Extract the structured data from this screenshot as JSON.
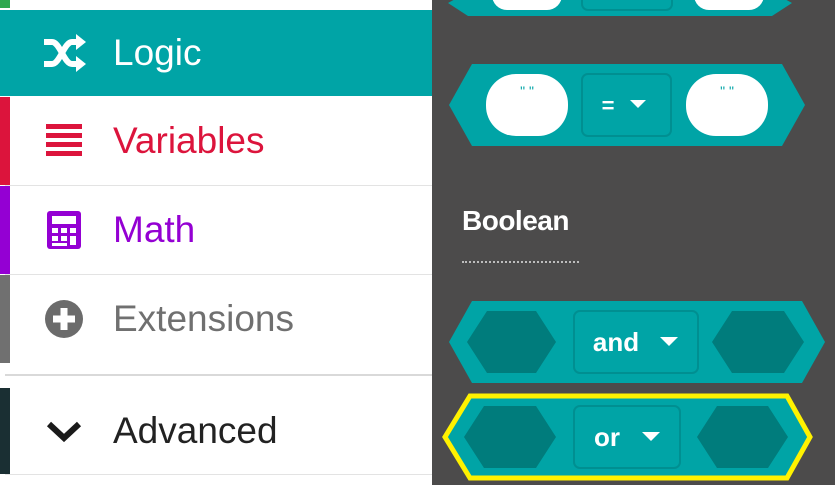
{
  "toolbox": {
    "categories": [
      {
        "label": "Logic",
        "icon": "shuffle-icon",
        "color": "#00a4a6",
        "selected": true
      },
      {
        "label": "Variables",
        "icon": "list-icon",
        "color": "#dc143c",
        "selected": false
      },
      {
        "label": "Math",
        "icon": "calculator-icon",
        "color": "#9400d3",
        "selected": false
      },
      {
        "label": "Extensions",
        "icon": "plus-circle-icon",
        "color": "#707070",
        "selected": false
      },
      {
        "label": "Advanced",
        "icon": "chevron-down-icon",
        "color": "#1a2f33",
        "selected": false
      }
    ]
  },
  "flyout": {
    "compare_block": {
      "operator": "=",
      "left_value": "\" \"",
      "right_value": "\" \""
    },
    "section_title": "Boolean",
    "and_block": {
      "operator": "and"
    },
    "or_block": {
      "operator": "or",
      "highlighted": true
    }
  },
  "colors": {
    "logic_block": "#00a4a6",
    "logic_block_dark": "#007c7c",
    "flyout_bg": "#4c4b4b",
    "highlight": "#fff200"
  }
}
